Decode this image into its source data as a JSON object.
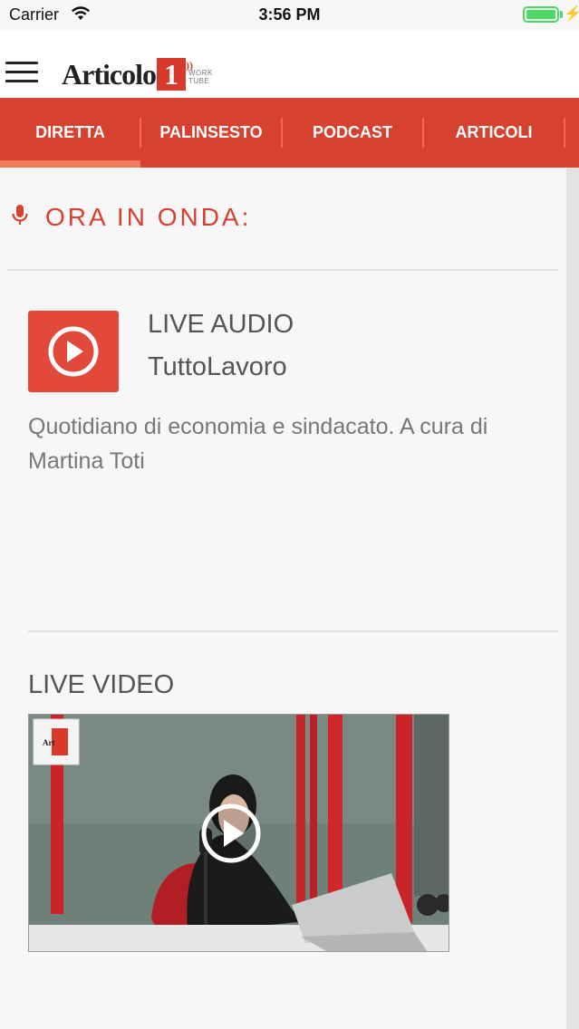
{
  "status_bar": {
    "carrier": "Carrier",
    "time": "3:56 PM",
    "battery_level": 1.0
  },
  "app_bar": {
    "logo_text": "Articolo",
    "logo_number": "1",
    "logo_sub_line1": "WORK",
    "logo_sub_line2": "TUBE"
  },
  "tabs": [
    {
      "label": "DIRETTA",
      "active": true
    },
    {
      "label": "PALINSESTO",
      "active": false
    },
    {
      "label": "PODCAST",
      "active": false
    },
    {
      "label": "ARTICOLI",
      "active": false
    }
  ],
  "on_air": {
    "icon": "microphone-icon",
    "label": "ORA IN ONDA:"
  },
  "now_playing": {
    "type_label": "LIVE AUDIO",
    "title": "TuttoLavoro",
    "description": "Quotidiano di economia e sindacato. A cura di Martina Toti"
  },
  "live_video": {
    "label": "LIVE VIDEO"
  },
  "colors": {
    "brand_red": "#d7412f",
    "play_button": "#e3493a",
    "tab_indicator": "#f07a5a"
  }
}
